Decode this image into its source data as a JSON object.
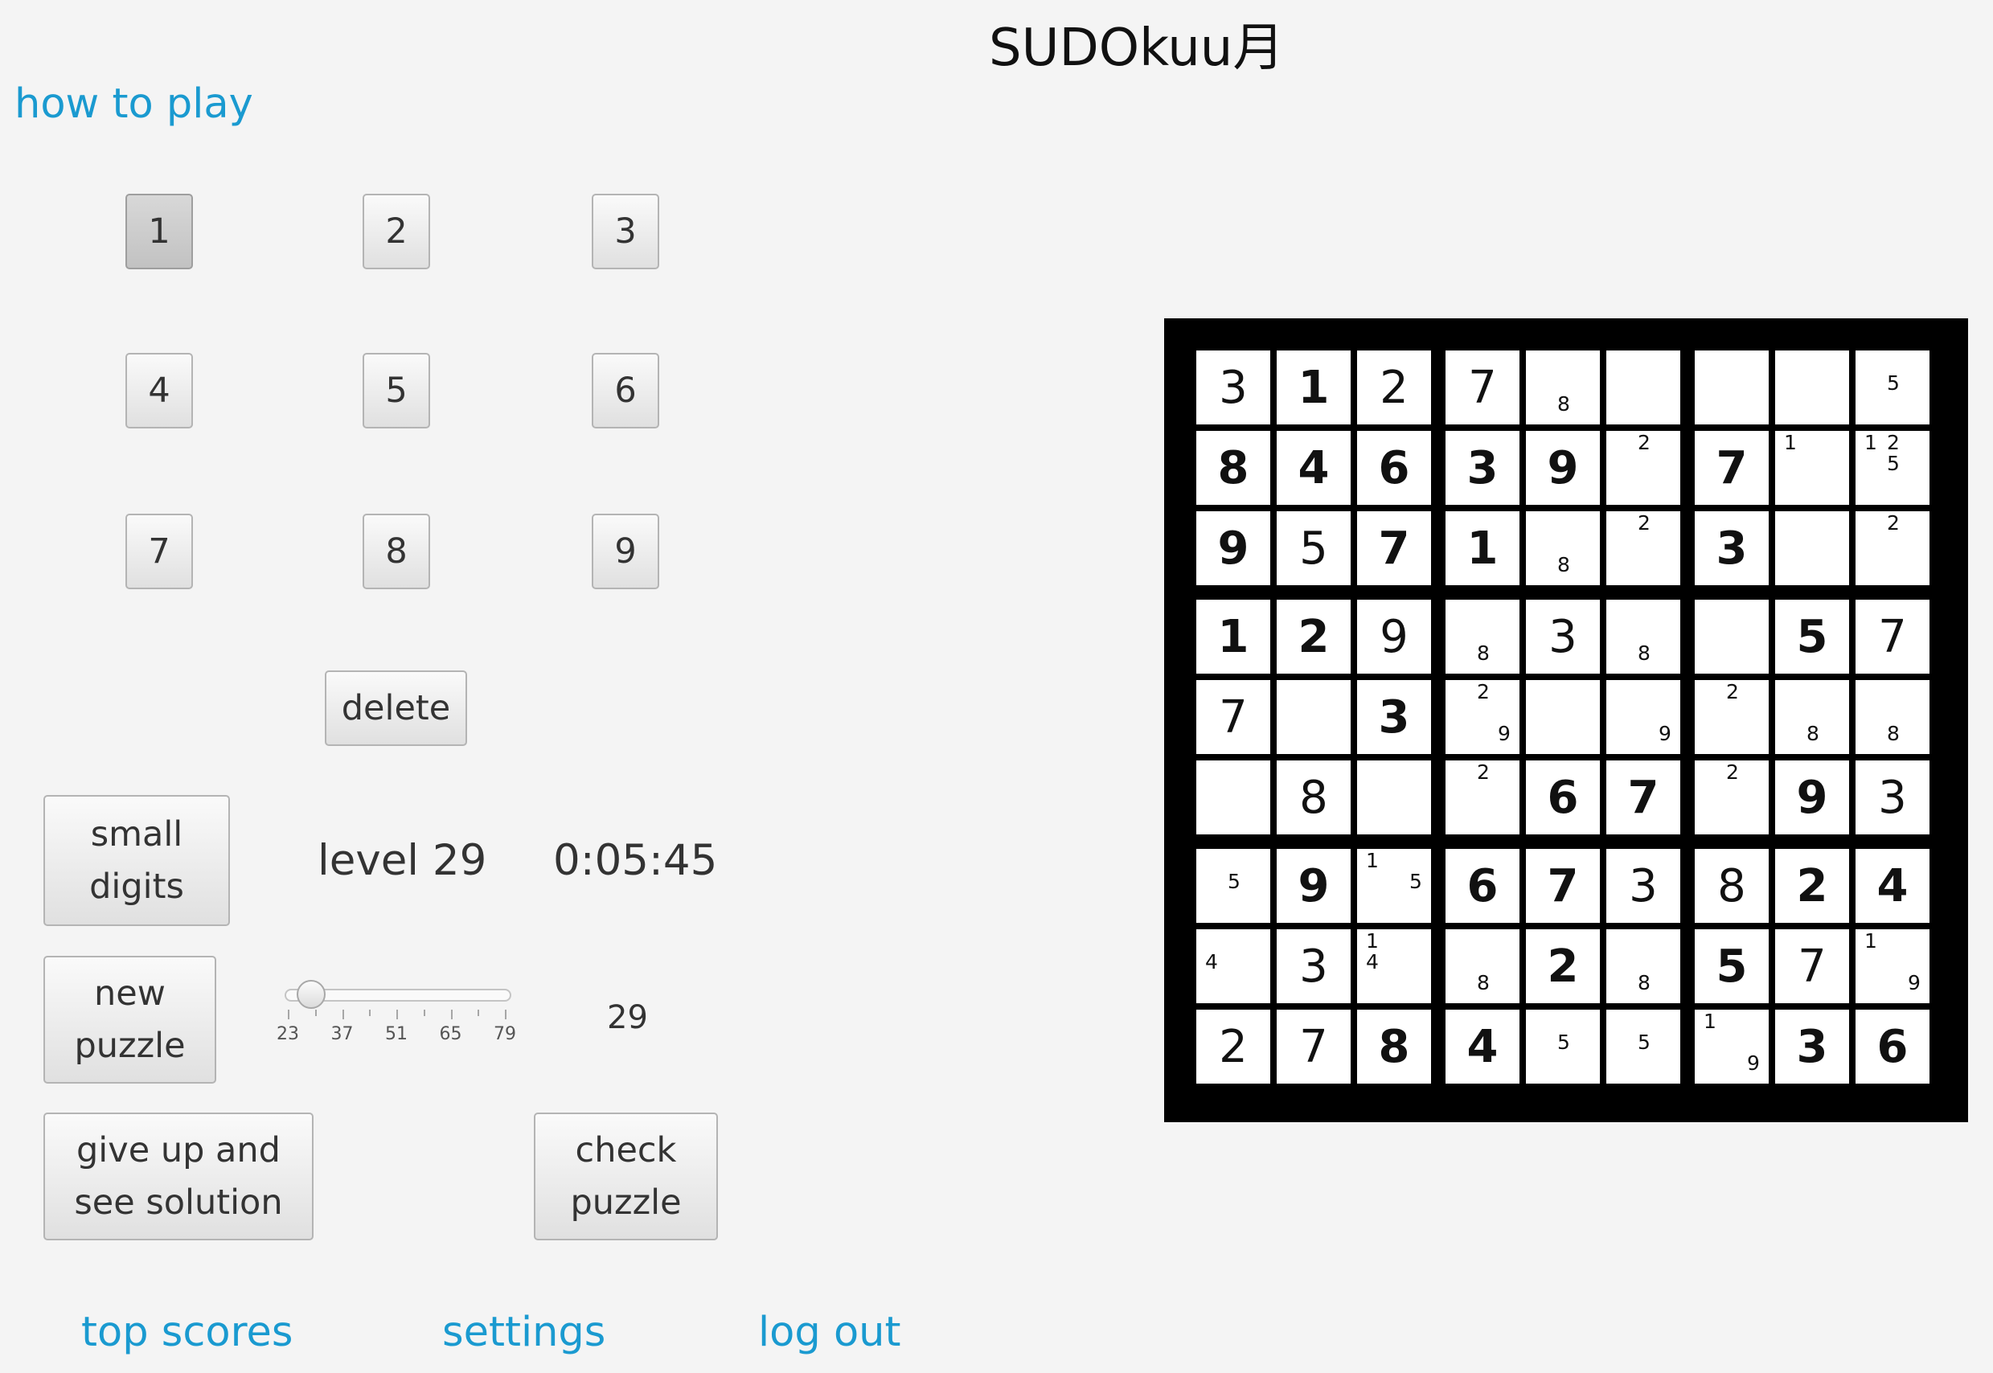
{
  "title": "SUDOkuu月",
  "links": {
    "how_to_play": "how to play",
    "top_scores": "top scores",
    "settings": "settings",
    "log_out": "log out"
  },
  "keypad": [
    "1",
    "2",
    "3",
    "4",
    "5",
    "6",
    "7",
    "8",
    "9"
  ],
  "selected_digit": "1",
  "buttons": {
    "delete": "delete",
    "small_digits": "small\ndigits",
    "new_puzzle": "new\npuzzle",
    "give_up": "give up and\nsee solution",
    "check_puzzle": "check\npuzzle"
  },
  "level_label": "level 29",
  "timer": "0:05:45",
  "slider": {
    "ticks": [
      "23",
      "37",
      "51",
      "65",
      "79"
    ],
    "min": 23,
    "max": 79,
    "value": 29,
    "value_label": "29"
  },
  "board": [
    [
      {
        "v": "3",
        "g": false
      },
      {
        "v": "1",
        "g": true
      },
      {
        "v": "2",
        "g": false
      },
      {
        "v": "7",
        "g": false
      },
      {
        "n": [
          "",
          "",
          "",
          "",
          "",
          "",
          "",
          "8",
          ""
        ]
      },
      {
        "v": ""
      },
      {
        "v": ""
      },
      {
        "v": ""
      },
      {
        "n": [
          "",
          "",
          "",
          "",
          "5",
          "",
          "",
          "",
          ""
        ]
      }
    ],
    [
      {
        "v": "8",
        "g": true
      },
      {
        "v": "4",
        "g": true
      },
      {
        "v": "6",
        "g": true
      },
      {
        "v": "3",
        "g": true
      },
      {
        "v": "9",
        "g": true
      },
      {
        "n": [
          "",
          "2",
          "",
          "",
          "",
          "",
          "",
          "",
          ""
        ]
      },
      {
        "v": "7",
        "g": true
      },
      {
        "n": [
          "1",
          "",
          "",
          "",
          "",
          "",
          "",
          "",
          ""
        ]
      },
      {
        "n": [
          "1",
          "2",
          "",
          "",
          "5",
          "",
          "",
          "",
          ""
        ]
      }
    ],
    [
      {
        "v": "9",
        "g": true
      },
      {
        "v": "5",
        "g": false
      },
      {
        "v": "7",
        "g": true
      },
      {
        "v": "1",
        "g": true
      },
      {
        "n": [
          "",
          "",
          "",
          "",
          "",
          "",
          "",
          "8",
          ""
        ]
      },
      {
        "n": [
          "",
          "2",
          "",
          "",
          "",
          "",
          "",
          "",
          ""
        ]
      },
      {
        "v": "3",
        "g": true
      },
      {
        "v": ""
      },
      {
        "n": [
          "",
          "2",
          "",
          "",
          "",
          "",
          "",
          "",
          ""
        ]
      }
    ],
    [
      {
        "v": "1",
        "g": true
      },
      {
        "v": "2",
        "g": true
      },
      {
        "v": "9",
        "g": false
      },
      {
        "n": [
          "",
          "",
          "",
          "",
          "",
          "",
          "",
          "8",
          ""
        ]
      },
      {
        "v": "3",
        "g": false
      },
      {
        "n": [
          "",
          "",
          "",
          "",
          "",
          "",
          "",
          "8",
          ""
        ]
      },
      {
        "v": ""
      },
      {
        "v": "5",
        "g": true
      },
      {
        "v": "7",
        "g": false
      }
    ],
    [
      {
        "v": "7",
        "g": false
      },
      {
        "v": ""
      },
      {
        "v": "3",
        "g": true
      },
      {
        "n": [
          "",
          "2",
          "",
          "",
          "",
          "",
          "",
          "",
          "9"
        ]
      },
      {
        "v": ""
      },
      {
        "n": [
          "",
          "",
          "",
          "",
          "",
          "",
          "",
          "",
          "9"
        ]
      },
      {
        "n": [
          "",
          "2",
          "",
          "",
          "",
          "",
          "",
          "",
          ""
        ]
      },
      {
        "n": [
          "",
          "",
          "",
          "",
          "",
          "",
          "",
          "8",
          ""
        ]
      },
      {
        "n": [
          "",
          "",
          "",
          "",
          "",
          "",
          "",
          "8",
          ""
        ]
      }
    ],
    [
      {
        "v": ""
      },
      {
        "v": "8",
        "g": false
      },
      {
        "v": ""
      },
      {
        "n": [
          "",
          "2",
          "",
          "",
          "",
          "",
          "",
          "",
          ""
        ]
      },
      {
        "v": "6",
        "g": true
      },
      {
        "v": "7",
        "g": true
      },
      {
        "n": [
          "",
          "2",
          "",
          "",
          "",
          "",
          "",
          "",
          ""
        ]
      },
      {
        "v": "9",
        "g": true
      },
      {
        "v": "3",
        "g": false
      }
    ],
    [
      {
        "n": [
          "",
          "",
          "",
          "",
          "5",
          "",
          "",
          "",
          ""
        ]
      },
      {
        "v": "9",
        "g": true
      },
      {
        "n": [
          "1",
          "",
          "",
          "",
          "",
          "5",
          "",
          "",
          ""
        ]
      },
      {
        "v": "6",
        "g": true
      },
      {
        "v": "7",
        "g": true
      },
      {
        "v": "3",
        "g": false
      },
      {
        "v": "8",
        "g": false
      },
      {
        "v": "2",
        "g": true
      },
      {
        "v": "4",
        "g": true
      }
    ],
    [
      {
        "n": [
          "",
          "",
          "",
          "4",
          "",
          "",
          "",
          "",
          ""
        ]
      },
      {
        "v": "3",
        "g": false
      },
      {
        "n": [
          "1",
          "",
          "",
          "4",
          "",
          "",
          "",
          "",
          ""
        ]
      },
      {
        "n": [
          "",
          "",
          "",
          "",
          "",
          "",
          "",
          "8",
          ""
        ]
      },
      {
        "v": "2",
        "g": true
      },
      {
        "n": [
          "",
          "",
          "",
          "",
          "",
          "",
          "",
          "8",
          ""
        ]
      },
      {
        "v": "5",
        "g": true
      },
      {
        "v": "7",
        "g": false
      },
      {
        "n": [
          "1",
          "",
          "",
          "",
          "",
          "",
          "",
          "",
          "9"
        ]
      }
    ],
    [
      {
        "v": "2",
        "g": false
      },
      {
        "v": "7",
        "g": false
      },
      {
        "v": "8",
        "g": true
      },
      {
        "v": "4",
        "g": true
      },
      {
        "n": [
          "",
          "",
          "",
          "",
          "5",
          "",
          "",
          "",
          ""
        ]
      },
      {
        "n": [
          "",
          "",
          "",
          "",
          "5",
          "",
          "",
          "",
          ""
        ]
      },
      {
        "n": [
          "1",
          "",
          "",
          "",
          "",
          "",
          "",
          "",
          "9"
        ]
      },
      {
        "v": "3",
        "g": true
      },
      {
        "v": "6",
        "g": true
      }
    ]
  ]
}
